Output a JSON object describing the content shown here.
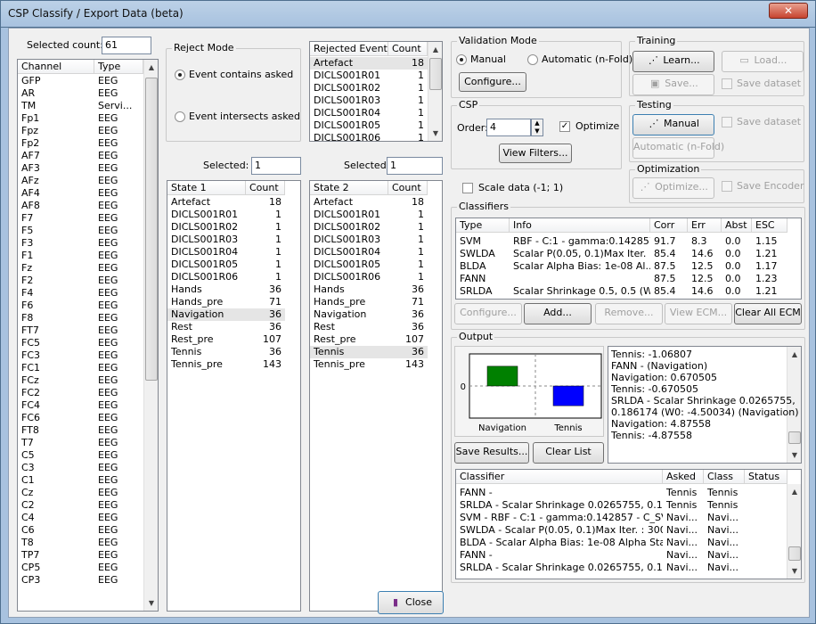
{
  "window": {
    "title": "CSP Classify / Export Data (beta)",
    "close_glyph": "✕"
  },
  "left": {
    "selected_count_label": "Selected count:",
    "selected_count_value": "61",
    "channel_headers": [
      "Channel",
      "Type"
    ],
    "channels": [
      [
        "GFP",
        "EEG"
      ],
      [
        "AR",
        "EEG"
      ],
      [
        "TM",
        "Servi..."
      ],
      [
        "Fp1",
        "EEG"
      ],
      [
        "Fpz",
        "EEG"
      ],
      [
        "Fp2",
        "EEG"
      ],
      [
        "AF7",
        "EEG"
      ],
      [
        "AF3",
        "EEG"
      ],
      [
        "AFz",
        "EEG"
      ],
      [
        "AF4",
        "EEG"
      ],
      [
        "AF8",
        "EEG"
      ],
      [
        "F7",
        "EEG"
      ],
      [
        "F5",
        "EEG"
      ],
      [
        "F3",
        "EEG"
      ],
      [
        "F1",
        "EEG"
      ],
      [
        "Fz",
        "EEG"
      ],
      [
        "F2",
        "EEG"
      ],
      [
        "F4",
        "EEG"
      ],
      [
        "F6",
        "EEG"
      ],
      [
        "F8",
        "EEG"
      ],
      [
        "FT7",
        "EEG"
      ],
      [
        "FC5",
        "EEG"
      ],
      [
        "FC3",
        "EEG"
      ],
      [
        "FC1",
        "EEG"
      ],
      [
        "FCz",
        "EEG"
      ],
      [
        "FC2",
        "EEG"
      ],
      [
        "FC4",
        "EEG"
      ],
      [
        "FC6",
        "EEG"
      ],
      [
        "FT8",
        "EEG"
      ],
      [
        "T7",
        "EEG"
      ],
      [
        "C5",
        "EEG"
      ],
      [
        "C3",
        "EEG"
      ],
      [
        "C1",
        "EEG"
      ],
      [
        "Cz",
        "EEG"
      ],
      [
        "C2",
        "EEG"
      ],
      [
        "C4",
        "EEG"
      ],
      [
        "C6",
        "EEG"
      ],
      [
        "T8",
        "EEG"
      ],
      [
        "TP7",
        "EEG"
      ],
      [
        "CP5",
        "EEG"
      ],
      [
        "CP3",
        "EEG"
      ]
    ]
  },
  "reject": {
    "title": "Reject Mode",
    "opt1": "Event contains asked",
    "opt2": "Event intersects asked",
    "rejected_headers": [
      "Rejected Event",
      "Count"
    ],
    "rejected": [
      [
        "Artefact",
        "18"
      ],
      [
        "DICLS001R01",
        "1"
      ],
      [
        "DICLS001R02",
        "1"
      ],
      [
        "DICLS001R03",
        "1"
      ],
      [
        "DICLS001R04",
        "1"
      ],
      [
        "DICLS001R05",
        "1"
      ],
      [
        "DICLS001R06",
        "1"
      ]
    ]
  },
  "state1": {
    "selected_label": "Selected:",
    "selected_value": "1",
    "headers": [
      "State 1",
      "Count"
    ],
    "rows": [
      [
        "Artefact",
        "18"
      ],
      [
        "DICLS001R01",
        "1"
      ],
      [
        "DICLS001R02",
        "1"
      ],
      [
        "DICLS001R03",
        "1"
      ],
      [
        "DICLS001R04",
        "1"
      ],
      [
        "DICLS001R05",
        "1"
      ],
      [
        "DICLS001R06",
        "1"
      ],
      [
        "Hands",
        "36"
      ],
      [
        "Hands_pre",
        "71"
      ],
      [
        "Navigation",
        "36"
      ],
      [
        "Rest",
        "36"
      ],
      [
        "Rest_pre",
        "107"
      ],
      [
        "Tennis",
        "36"
      ],
      [
        "Tennis_pre",
        "143"
      ]
    ]
  },
  "state2": {
    "selected_label": "Selected:",
    "selected_value": "1",
    "headers": [
      "State 2",
      "Count"
    ],
    "rows": [
      [
        "Artefact",
        "18"
      ],
      [
        "DICLS001R01",
        "1"
      ],
      [
        "DICLS001R02",
        "1"
      ],
      [
        "DICLS001R03",
        "1"
      ],
      [
        "DICLS001R04",
        "1"
      ],
      [
        "DICLS001R05",
        "1"
      ],
      [
        "DICLS001R06",
        "1"
      ],
      [
        "Hands",
        "36"
      ],
      [
        "Hands_pre",
        "71"
      ],
      [
        "Navigation",
        "36"
      ],
      [
        "Rest",
        "36"
      ],
      [
        "Rest_pre",
        "107"
      ],
      [
        "Tennis",
        "36"
      ],
      [
        "Tennis_pre",
        "143"
      ]
    ]
  },
  "validation": {
    "title": "Validation Mode",
    "manual": "Manual",
    "auto": "Automatic (n-Fold)",
    "configure": "Configure..."
  },
  "training": {
    "title": "Training",
    "learn": "Learn...",
    "load": "Load...",
    "save": "Save...",
    "save_dataset": "Save dataset"
  },
  "testing": {
    "title": "Testing",
    "manual": "Manual",
    "auto": "Automatic (n-Fold)",
    "save_dataset": "Save dataset"
  },
  "csp": {
    "title": "CSP",
    "order_label": "Order:",
    "order_value": "4",
    "optimize": "Optimize",
    "view_filters": "View Filters...",
    "scale": "Scale data (-1; 1)"
  },
  "optimization": {
    "title": "Optimization",
    "optimize": "Optimize...",
    "save_encoder": "Save Encoder"
  },
  "classifiers": {
    "title": "Classifiers",
    "headers": [
      "Type",
      "Info",
      "Corr",
      "Err",
      "Abst",
      "ESC"
    ],
    "rows": [
      [
        "SVM",
        "RBF - C:1 - gamma:0.142857...",
        "91.7",
        "8.3",
        "0.0",
        "1.15"
      ],
      [
        "SWLDA",
        "Scalar P(0.05, 0.1)Max Iter. ...",
        "85.4",
        "14.6",
        "0.0",
        "1.21"
      ],
      [
        "BLDA",
        "Scalar Alpha Bias: 1e-08 Al...",
        "87.5",
        "12.5",
        "0.0",
        "1.17"
      ],
      [
        "FANN",
        "",
        "87.5",
        "12.5",
        "0.0",
        "1.23"
      ],
      [
        "SRLDA",
        "Scalar Shrinkage 0.5, 0.5 (W...",
        "85.4",
        "14.6",
        "0.0",
        "1.21"
      ]
    ],
    "configure": "Configure...",
    "add": "Add...",
    "remove": "Remove...",
    "view_ecm": "View ECM...",
    "clear_all": "Clear All ECM"
  },
  "output": {
    "title": "Output",
    "chart_data": {
      "type": "bar",
      "categories": [
        "Navigation",
        "Tennis"
      ],
      "values": [
        0.670505,
        -0.670505
      ],
      "colors": [
        "#008000",
        "#0000ff"
      ],
      "zero_label": "0"
    },
    "log": [
      "Tennis: -1.06807",
      "FANN - (Navigation)",
      "Navigation: 0.670505",
      "Tennis: -0.670505",
      "SRLDA - Scalar Shrinkage 0.0265755,",
      "0.186174 (W0: -4.50034) (Navigation)",
      "Navigation: 4.87558",
      "Tennis: -4.87558"
    ],
    "save_results": "Save Results...",
    "clear_list": "Clear List",
    "result_headers": [
      "Classifier",
      "Asked",
      "Class",
      "Status"
    ],
    "results": [
      [
        "FANN -",
        "Tennis",
        "Tennis",
        ""
      ],
      [
        "SRLDA - Scalar Shrinkage 0.0265755, 0.186...",
        "Tennis",
        "Tennis",
        ""
      ],
      [
        "SVM - RBF - C:1 - gamma:0.142857 - C_SVC",
        "Navi...",
        "Navi...",
        ""
      ],
      [
        "SWLDA - Scalar P(0.05, 0.1)Max Iter. : 300",
        "Navi...",
        "Navi...",
        ""
      ],
      [
        "BLDA - Scalar  Alpha Bias: 1e-08 Alpha Start...",
        "Navi...",
        "Navi...",
        ""
      ],
      [
        "FANN -",
        "Navi...",
        "Navi...",
        ""
      ],
      [
        "SRLDA - Scalar Shrinkage 0.0265755, 0.186...",
        "Navi...",
        "Navi...",
        ""
      ]
    ]
  },
  "footer": {
    "close": "Close"
  }
}
